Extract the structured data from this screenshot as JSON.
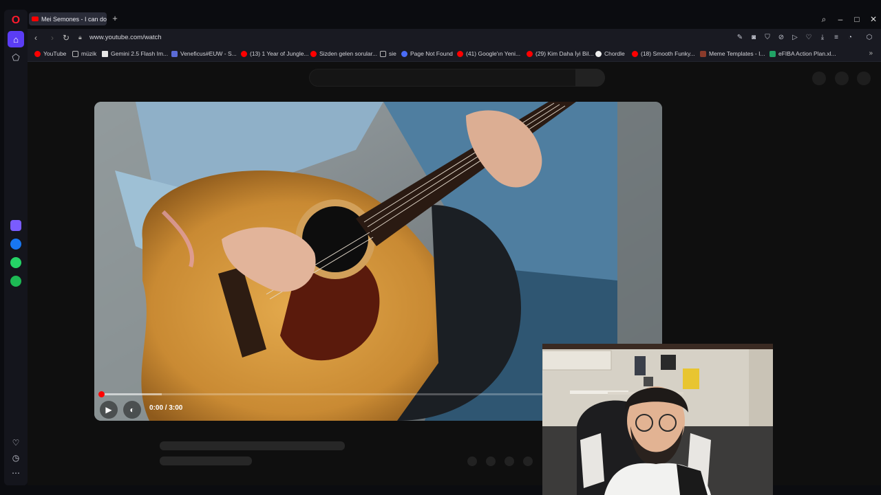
{
  "browser": {
    "tab": {
      "title": "Mei Semones - I can do w"
    },
    "url": "www.youtube.com/watch",
    "bookmarks": [
      {
        "label": "YouTube",
        "icon": "youtube-icon"
      },
      {
        "label": "müzik",
        "icon": "folder-icon"
      },
      {
        "label": "Gemini 2.5 Flash Im...",
        "icon": "page-icon"
      },
      {
        "label": "Veneficus#EUW - S...",
        "icon": "app-icon"
      },
      {
        "label": "(13) 1 Year of Jungle...",
        "icon": "youtube-icon"
      },
      {
        "label": "Sizden gelen sorular...",
        "icon": "youtube-icon"
      },
      {
        "label": "sie",
        "icon": "folder-icon"
      },
      {
        "label": "Page Not Found",
        "icon": "app-icon"
      },
      {
        "label": "(41) Google'ın Yeni...",
        "icon": "youtube-icon"
      },
      {
        "label": "(29) Kim Daha İyi Bil...",
        "icon": "youtube-icon"
      },
      {
        "label": "Chordle",
        "icon": "chordle-icon"
      },
      {
        "label": "(18) Smooth Funky...",
        "icon": "youtube-icon"
      },
      {
        "label": "Meme Templates - I...",
        "icon": "app-icon"
      },
      {
        "label": "eFIBA Action Plan.xl...",
        "icon": "sheet-icon"
      }
    ]
  },
  "player": {
    "time": "0:00 / 3:00",
    "progress_fraction": 0.0,
    "buffered_fraction": 0.11
  },
  "colors": {
    "accent": "#5b3df5",
    "opera_red": "#ff1b2d",
    "youtube_red": "#ff0000",
    "messenger": "#1877f2",
    "whatsapp": "#25d366",
    "spotify": "#1db954"
  }
}
